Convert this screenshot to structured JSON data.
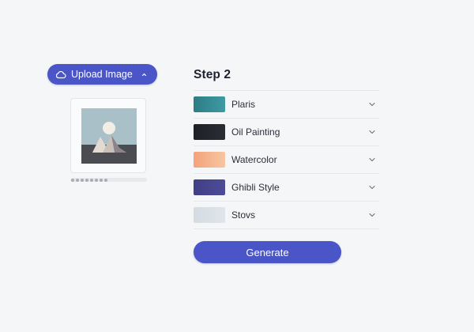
{
  "upload": {
    "label": "Upload Image",
    "icon": "cloud-icon",
    "caret_icon": "chevron-up-icon"
  },
  "preview": {
    "icon": "image-placeholder-icon",
    "progress_dots": 8
  },
  "step": {
    "title": "Step 2",
    "items": [
      {
        "label": "Plaris",
        "swatch": [
          "#2e7c86",
          "#3e9aa3"
        ]
      },
      {
        "label": "Oil Painting",
        "swatch": [
          "#1d2026",
          "#2a2d33"
        ]
      },
      {
        "label": "Watercolor",
        "swatch": [
          "#f4a27a",
          "#f6c6a1"
        ]
      },
      {
        "label": "Ghibli Style",
        "swatch": [
          "#3f3f86",
          "#4e4c97"
        ]
      },
      {
        "label": "Stovs",
        "swatch": [
          "#d4dbe2",
          "#dfe5ea"
        ]
      }
    ]
  },
  "generate": {
    "label": "Generate"
  },
  "colors": {
    "accent": "#4a55c8",
    "background": "#f5f6f8"
  }
}
